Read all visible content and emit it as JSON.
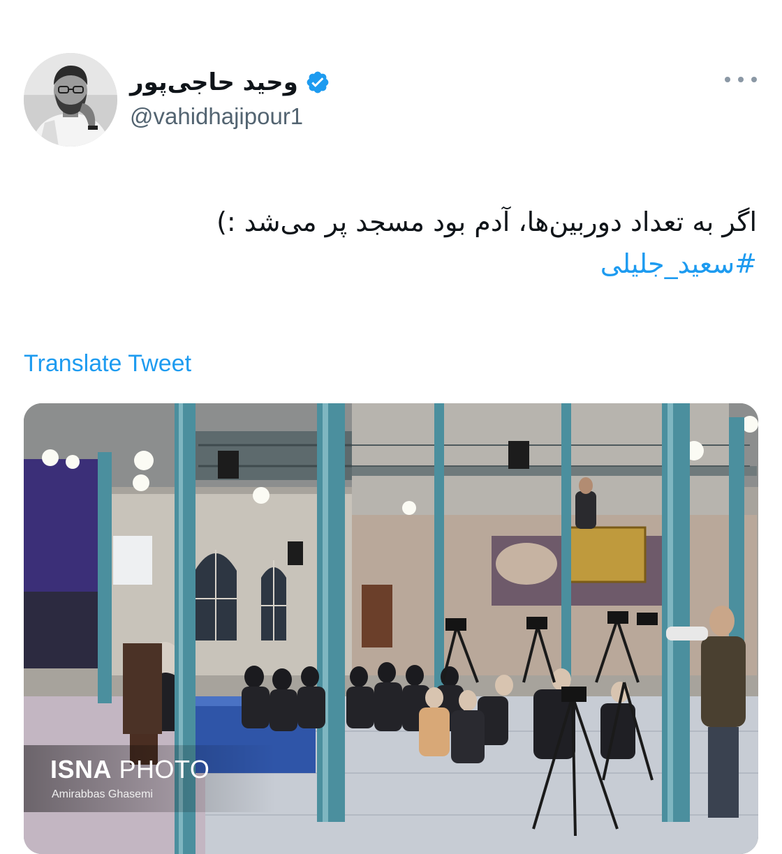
{
  "author": {
    "display_name": "وحید حاجی‌پور",
    "handle": "@vahidhajipour1",
    "verified": true
  },
  "icons": {
    "verified": "verified-badge-icon",
    "more": "more-options-icon"
  },
  "tweet": {
    "line1": "اگر به تعداد دوربین‌ها، آدم بود مسجد پر می‌شد :)",
    "hashtag": "#سعید_جلیلی"
  },
  "translate_label": "Translate Tweet",
  "media": {
    "watermark_brand_bold": "ISNA",
    "watermark_brand_light": " PHOTO",
    "photographer": "Amirabbas Ghasemi"
  },
  "colors": {
    "link": "#1d9bf0",
    "text": "#0f1419",
    "secondary": "#536471"
  }
}
